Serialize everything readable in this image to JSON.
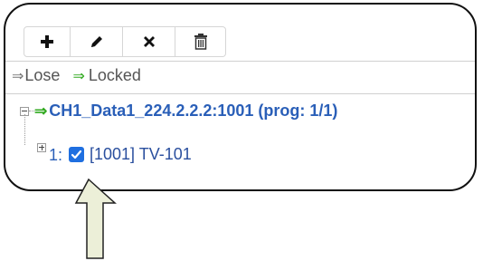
{
  "toolbar": {
    "buttons": [
      {
        "name": "add",
        "icon": "plus-icon"
      },
      {
        "name": "edit",
        "icon": "pencil-icon"
      },
      {
        "name": "remove",
        "icon": "x-icon"
      },
      {
        "name": "delete",
        "icon": "trash-icon"
      }
    ]
  },
  "legend": {
    "lose_arrow": "⇒",
    "lose_label": "Lose",
    "locked_arrow": "⇒",
    "locked_label": "Locked",
    "lose_color": "#777777",
    "locked_color": "#33aa22"
  },
  "tree": {
    "root": {
      "arrow": "⇒",
      "label": "CH1_Data1_224.2.2.2:1001 (prog: 1/1)",
      "expanded": true,
      "color": "#2a5fb8"
    },
    "child": {
      "index": "1:",
      "checked": true,
      "label": "[1001] TV-101",
      "expanded": false
    }
  },
  "annotation": {
    "icon": "up-arrow-icon",
    "fill": "#ecefd8"
  }
}
